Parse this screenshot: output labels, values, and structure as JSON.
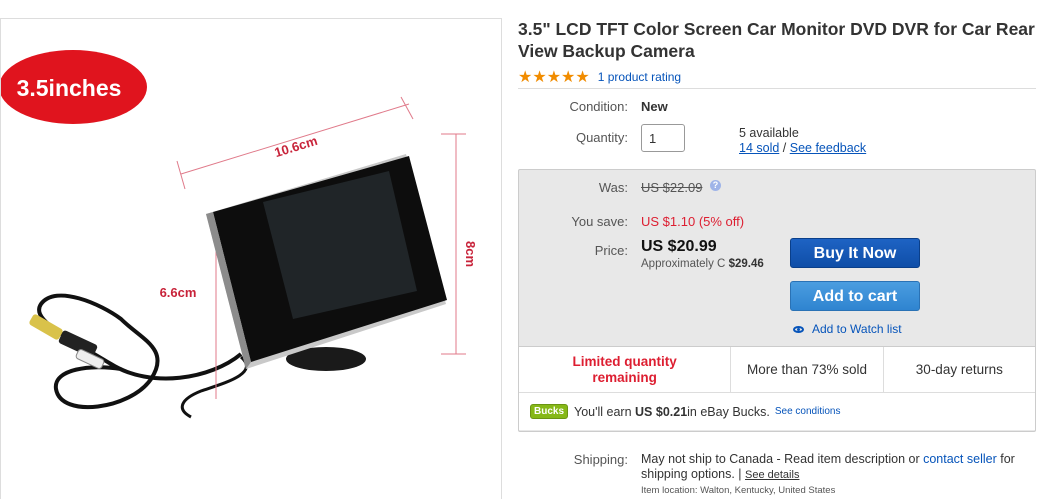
{
  "image": {
    "badge": "3.5inches",
    "dim_width": "10.6cm",
    "dim_height": "8cm",
    "dim_depth": "6.6cm"
  },
  "product": {
    "title": "3.5\" LCD TFT Color Screen Car Monitor DVD DVR for Car Rear View Backup Camera",
    "stars": "★★★★★",
    "rating_text": "1 product rating"
  },
  "details": {
    "condition_label": "Condition:",
    "condition_value": "New",
    "quantity_label": "Quantity:",
    "quantity_value": "1",
    "available": "5 available",
    "sold": "14 sold",
    "separator": " / ",
    "feedback": "See feedback"
  },
  "pricing": {
    "was_label": "Was:",
    "was_price": "US $22.09",
    "help_icon": "?",
    "save_label": "You save:",
    "save_value": "US $1.10 (5% off)",
    "price_label": "Price:",
    "price": "US $20.99",
    "approx_text": "Approximately C ",
    "approx_value": "$29.46"
  },
  "actions": {
    "buy_now": "Buy It Now",
    "add_to_cart": "Add to cart",
    "watch": "Add to Watch list"
  },
  "signals": {
    "limited": "Limited quantity remaining",
    "sold_pct": "More than 73% sold",
    "returns": "30-day returns"
  },
  "bucks": {
    "badge": "Bucks",
    "text_prefix": "You'll earn ",
    "amount": "US $0.21",
    "text_suffix": " in eBay Bucks.",
    "see_conditions": "See conditions"
  },
  "shipping": {
    "label": "Shipping:",
    "text1": "May not ship to Canada - Read item description or ",
    "contact": "contact seller",
    "text2": " for shipping options. | ",
    "see_details": "See details",
    "item_location": "Item location:  Walton, Kentucky, United States"
  },
  "colors": {
    "accent_blue": "#0654ba",
    "star_orange": "#f18c00",
    "alert_red": "#dd1e31",
    "badge_red": "#e0141e"
  }
}
